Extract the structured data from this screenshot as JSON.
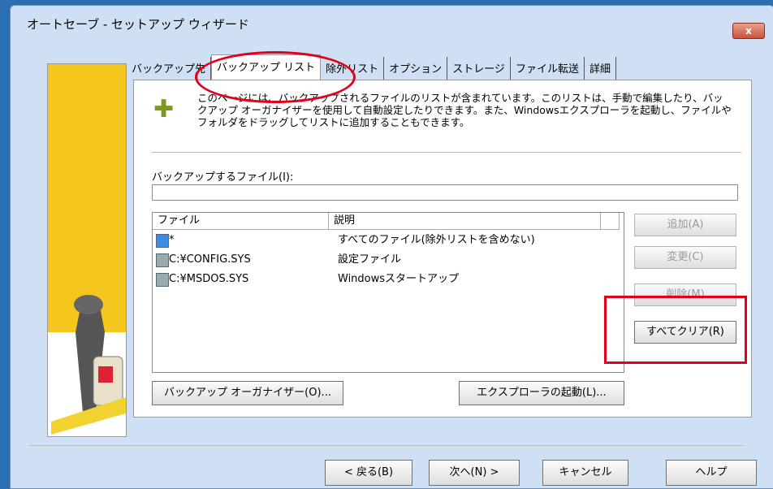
{
  "window": {
    "title": "オートセーブ - セットアップ ウィザード",
    "close_label": "x"
  },
  "tabs": [
    {
      "label": "バックアップ先"
    },
    {
      "label": "バックアップ リスト"
    },
    {
      "label": "除外リスト"
    },
    {
      "label": "オプション"
    },
    {
      "label": "ストレージ"
    },
    {
      "label": "ファイル転送"
    },
    {
      "label": "詳細"
    }
  ],
  "panel": {
    "description": "このページには、バックアップされるファイルのリストが含まれています。このリストは、手動で編集したり、バックアップ オーガナイザーを使用して自動設定したりできます。また、Windowsエクスプローラを起動し、ファイルやフォルダをドラッグしてリストに追加することもできます。",
    "files_label": "バックアップするファイル(I):",
    "files_value": "",
    "list": {
      "headers": {
        "file": "ファイル",
        "description": "説明"
      },
      "rows": [
        {
          "file": "*",
          "description": "すべてのファイル(除外リストを含めない)"
        },
        {
          "file": "C:¥CONFIG.SYS",
          "description": "設定ファイル"
        },
        {
          "file": "C:¥MSDOS.SYS",
          "description": "Windowsスタートアップ"
        }
      ]
    },
    "buttons": {
      "add": "追加(A)",
      "change": "変更(C)",
      "delete": "削除(M)",
      "clear_all": "すべてクリア(R)",
      "organizer": "バックアップ オーガナイザー(O)...",
      "explorer": "エクスプローラの起動(L)..."
    }
  },
  "nav": {
    "back": "< 戻る(B)",
    "next": "次へ(N) >",
    "cancel": "キャンセル",
    "help": "ヘルプ"
  }
}
